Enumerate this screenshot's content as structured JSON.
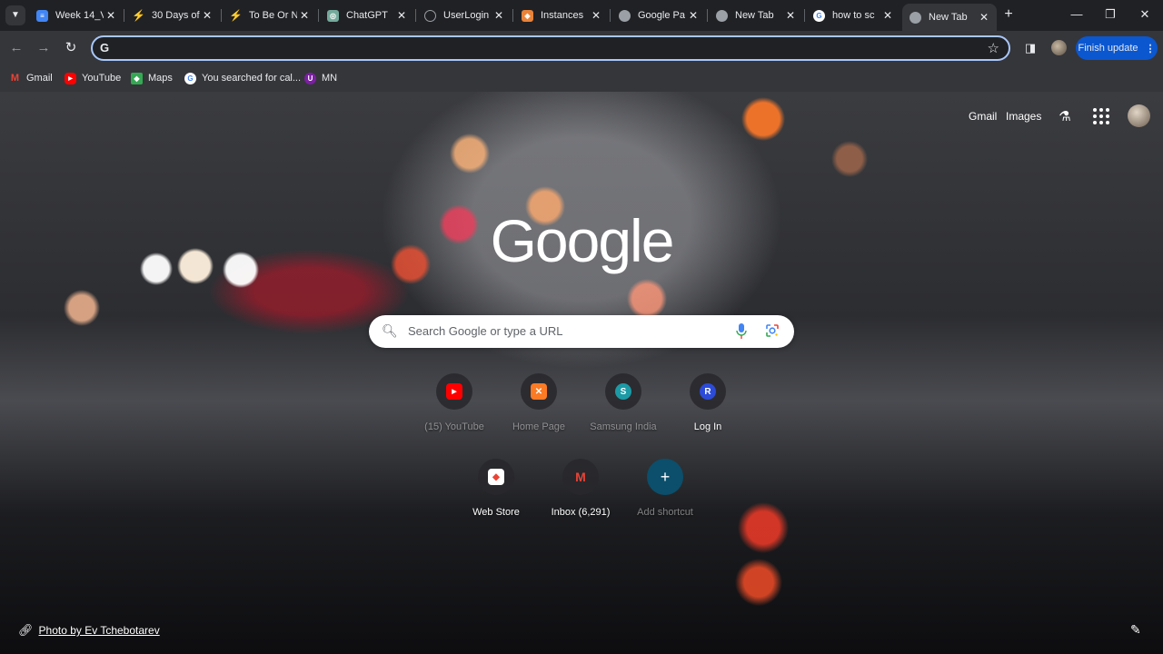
{
  "tabs": [
    {
      "title": "Week 14_V",
      "favicon": "docs-icon",
      "color": "#4285f4"
    },
    {
      "title": "30 Days of",
      "favicon": "bolt-icon",
      "color": "#e5a028"
    },
    {
      "title": "To Be Or N",
      "favicon": "bolt-icon",
      "color": "#e5a028"
    },
    {
      "title": "ChatGPT",
      "favicon": "chatgpt-icon",
      "color": "#74aa9c"
    },
    {
      "title": "UserLogin",
      "favicon": "globe-icon",
      "color": "#9aa0a6"
    },
    {
      "title": "Instances",
      "favicon": "aws-icon",
      "color": "#e8833a"
    },
    {
      "title": "Google Pa",
      "favicon": "chrome-icon",
      "color": "#9aa0a6"
    },
    {
      "title": "New Tab",
      "favicon": "chrome-icon",
      "color": "#9aa0a6"
    },
    {
      "title": "how to sc",
      "favicon": "google-icon",
      "color": "#4285f4"
    },
    {
      "title": "New Tab",
      "favicon": "chrome-icon",
      "color": "#9aa0a6",
      "active": true
    }
  ],
  "toolbar": {
    "omnibox_value": "",
    "finish_update": "Finish update"
  },
  "bookmarks": [
    {
      "label": "Gmail",
      "icon": "gmail-icon",
      "color": "#ea4335"
    },
    {
      "label": "YouTube",
      "icon": "youtube-icon",
      "color": "#ff0000"
    },
    {
      "label": "Maps",
      "icon": "maps-icon",
      "color": "#34a853"
    },
    {
      "label": "You searched for cal...",
      "icon": "google-icon",
      "color": "#4285f4"
    },
    {
      "label": "MN",
      "icon": "mn-icon",
      "color": "#7b1fa2"
    }
  ],
  "ntp": {
    "links": {
      "gmail": "Gmail",
      "images": "Images"
    },
    "logo": "Google",
    "search_placeholder": "Search Google or type a URL",
    "shortcuts": [
      {
        "label": "(15) YouTube",
        "icon": "youtube-icon",
        "letter": "▶",
        "color": "#ff0000",
        "faded": true
      },
      {
        "label": "Home Page",
        "icon": "xampp-icon",
        "letter": "✕",
        "color": "#fb7a24",
        "faded": true
      },
      {
        "label": "Samsung India",
        "icon": "samsung-icon",
        "letter": "S",
        "color": "#1c9aa6",
        "faded": true
      },
      {
        "label": "Log In",
        "icon": "login-icon",
        "letter": "R",
        "color": "#2c4bd8",
        "faded": false
      },
      {
        "label": "Web Store",
        "icon": "webstore-icon",
        "letter": "◆",
        "color": "#ffffff",
        "faded": false
      },
      {
        "label": "Inbox (6,291)",
        "icon": "gmail-icon",
        "letter": "M",
        "color": "#ea4335",
        "faded": false
      },
      {
        "label": "Add shortcut",
        "icon": "plus-icon",
        "letter": "+",
        "color": "#0b4f6c",
        "faded": true
      }
    ],
    "credit": "Photo by Ev Tchebotarev"
  }
}
